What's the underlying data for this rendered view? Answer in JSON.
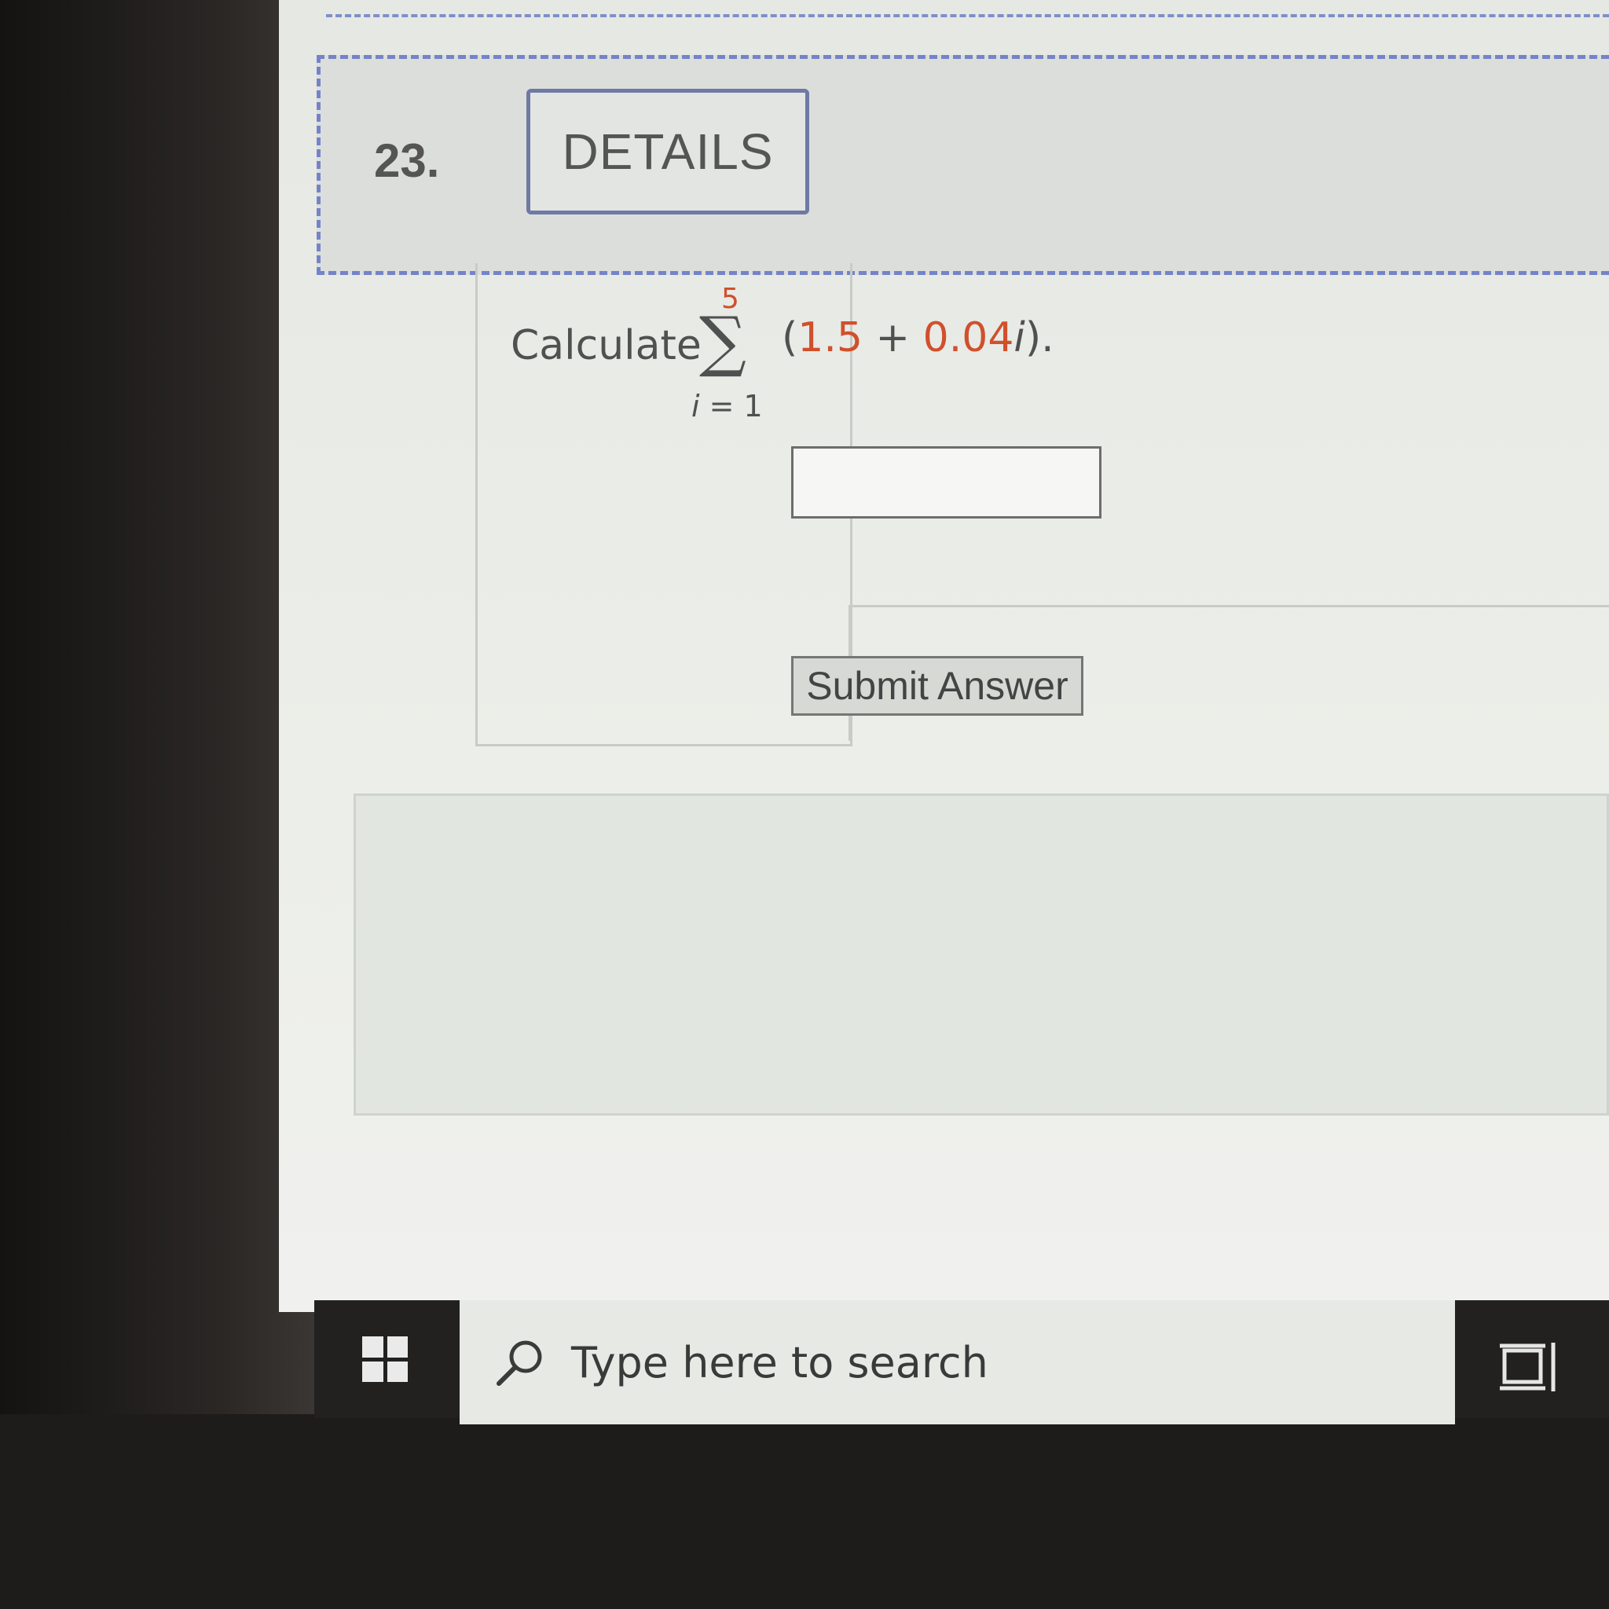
{
  "question": {
    "number": "23.",
    "details_label": "DETAILS",
    "prompt_word": "Calculate",
    "sum": {
      "upper": "5",
      "symbol": "∑",
      "lower_var": "i",
      "lower_eq": " = 1",
      "expr_open": "(",
      "expr_const": "1.5",
      "expr_plus": " + ",
      "expr_coef": "0.04",
      "expr_var": "i",
      "expr_close": ")."
    },
    "answer_value": "",
    "submit_label": "Submit Answer"
  },
  "taskbar": {
    "start_icon": "windows-logo-icon",
    "search_placeholder": "Type here to search",
    "search_icon": "search-icon",
    "taskview_icon": "task-view-icon"
  },
  "colors": {
    "accent_dashed": "#7584c8",
    "math_red": "#d0502c"
  }
}
